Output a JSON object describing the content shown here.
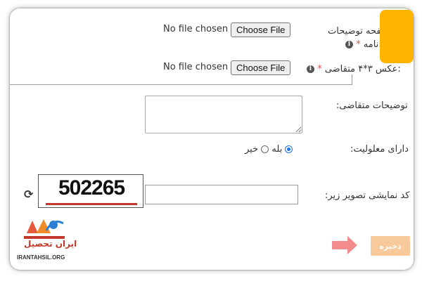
{
  "form": {
    "file_row_1": {
      "no_file_text": "No file chosen",
      "button_label": "Choose File",
      "label_line1": "صفحه توضیحات",
      "label_line2": "نامه:",
      "required_mark": "*"
    },
    "file_row_2": {
      "no_file_text": "No file chosen",
      "button_label": "Choose File",
      "label": "عکس ۳*۴ متقاضی:",
      "required_mark": "*"
    },
    "description": {
      "label": "توضیحات متقاضی:",
      "value": ""
    },
    "disability": {
      "label": "دارای معلولیت:",
      "option_no": "خیر",
      "option_yes": "بله",
      "selected": "خیر"
    },
    "captcha": {
      "label": "کد نمایشی تصویر زیر:",
      "code": "502265",
      "input_value": ""
    },
    "save_label": "ذخیره"
  },
  "logo": {
    "name": "ایران تحصیل",
    "site": "IRANTAHSIL.ORG"
  },
  "colors": {
    "accent_orange": "#ffb400",
    "save_button": "#f7c99b",
    "arrow_pink": "#f28b8b",
    "required_red": "#d9534f"
  }
}
